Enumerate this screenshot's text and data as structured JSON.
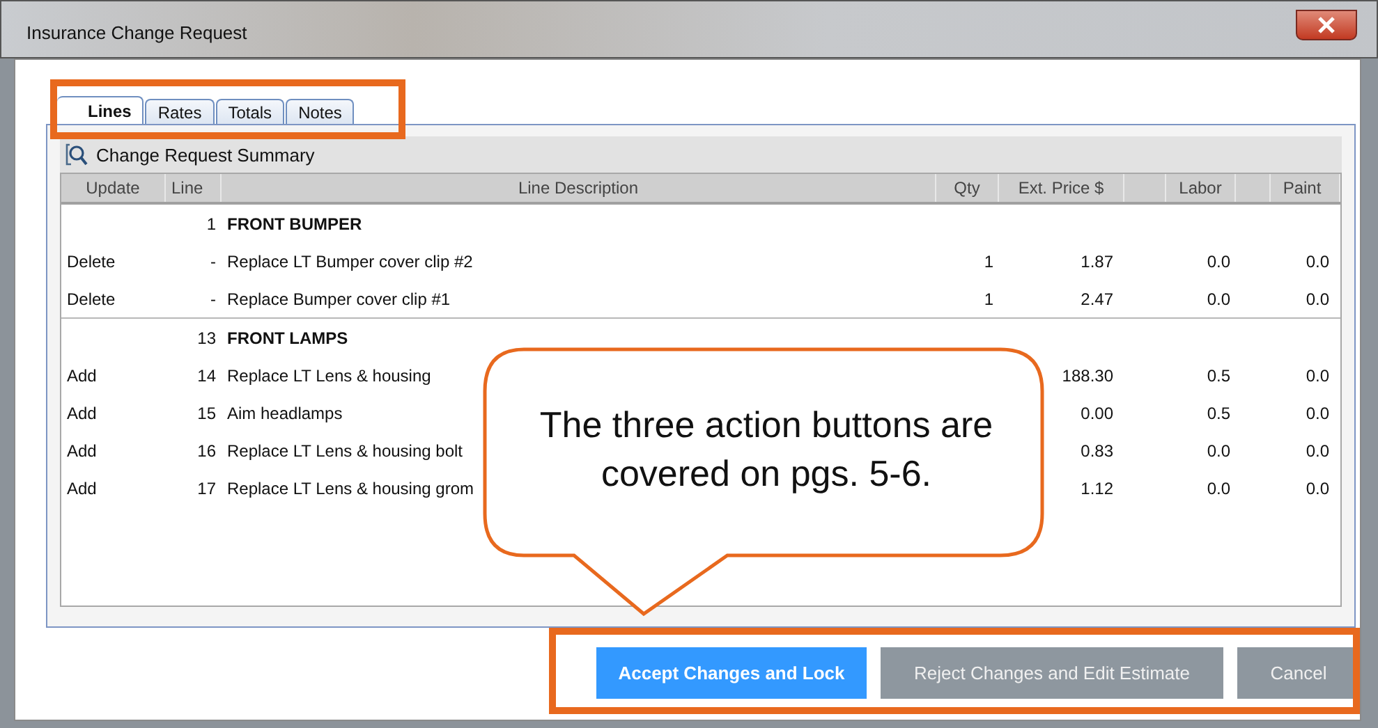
{
  "window": {
    "title": "Insurance Change Request"
  },
  "tabs": [
    {
      "label": "Lines",
      "selected": true
    },
    {
      "label": "Rates",
      "selected": false
    },
    {
      "label": "Totals",
      "selected": false
    },
    {
      "label": "Notes",
      "selected": false
    }
  ],
  "summary": {
    "title": "Change Request Summary"
  },
  "table": {
    "columns": [
      "Update",
      "Line",
      "Line Description",
      "Qty",
      "Ext. Price $",
      "Labor",
      "Paint"
    ],
    "rows": [
      {
        "kind": "group",
        "line": "1",
        "description": "FRONT BUMPER"
      },
      {
        "kind": "item",
        "update": "Delete",
        "line": "-",
        "description": "Replace LT Bumper cover clip #2",
        "qty": "1",
        "ext_price": "1.87",
        "labor": "0.0",
        "paint": "0.0"
      },
      {
        "kind": "item",
        "update": "Delete",
        "line": "-",
        "description": "Replace Bumper cover clip #1",
        "qty": "1",
        "ext_price": "2.47",
        "labor": "0.0",
        "paint": "0.0"
      },
      {
        "kind": "group",
        "line": "13",
        "description": "FRONT LAMPS"
      },
      {
        "kind": "item",
        "update": "Add",
        "line": "14",
        "description": "Replace LT Lens & housing",
        "ext_price": "188.30",
        "labor": "0.5",
        "paint": "0.0"
      },
      {
        "kind": "item",
        "update": "Add",
        "line": "15",
        "description": "Aim headlamps",
        "ext_price": "0.00",
        "labor": "0.5",
        "paint": "0.0"
      },
      {
        "kind": "item",
        "update": "Add",
        "line": "16",
        "description": "Replace LT Lens & housing bolt",
        "ext_price": "0.83",
        "labor": "0.0",
        "paint": "0.0"
      },
      {
        "kind": "item",
        "update": "Add",
        "line": "17",
        "description": "Replace LT Lens & housing grom",
        "ext_price": "1.12",
        "labor": "0.0",
        "paint": "0.0"
      }
    ]
  },
  "buttons": [
    {
      "label": "Accept Changes and Lock",
      "kind": "primary"
    },
    {
      "label": "Reject Changes and Edit Estimate",
      "kind": "secondary"
    },
    {
      "label": "Cancel",
      "kind": "secondary"
    }
  ],
  "callout": {
    "text": "The three action buttons are covered on pgs. 5-6."
  }
}
